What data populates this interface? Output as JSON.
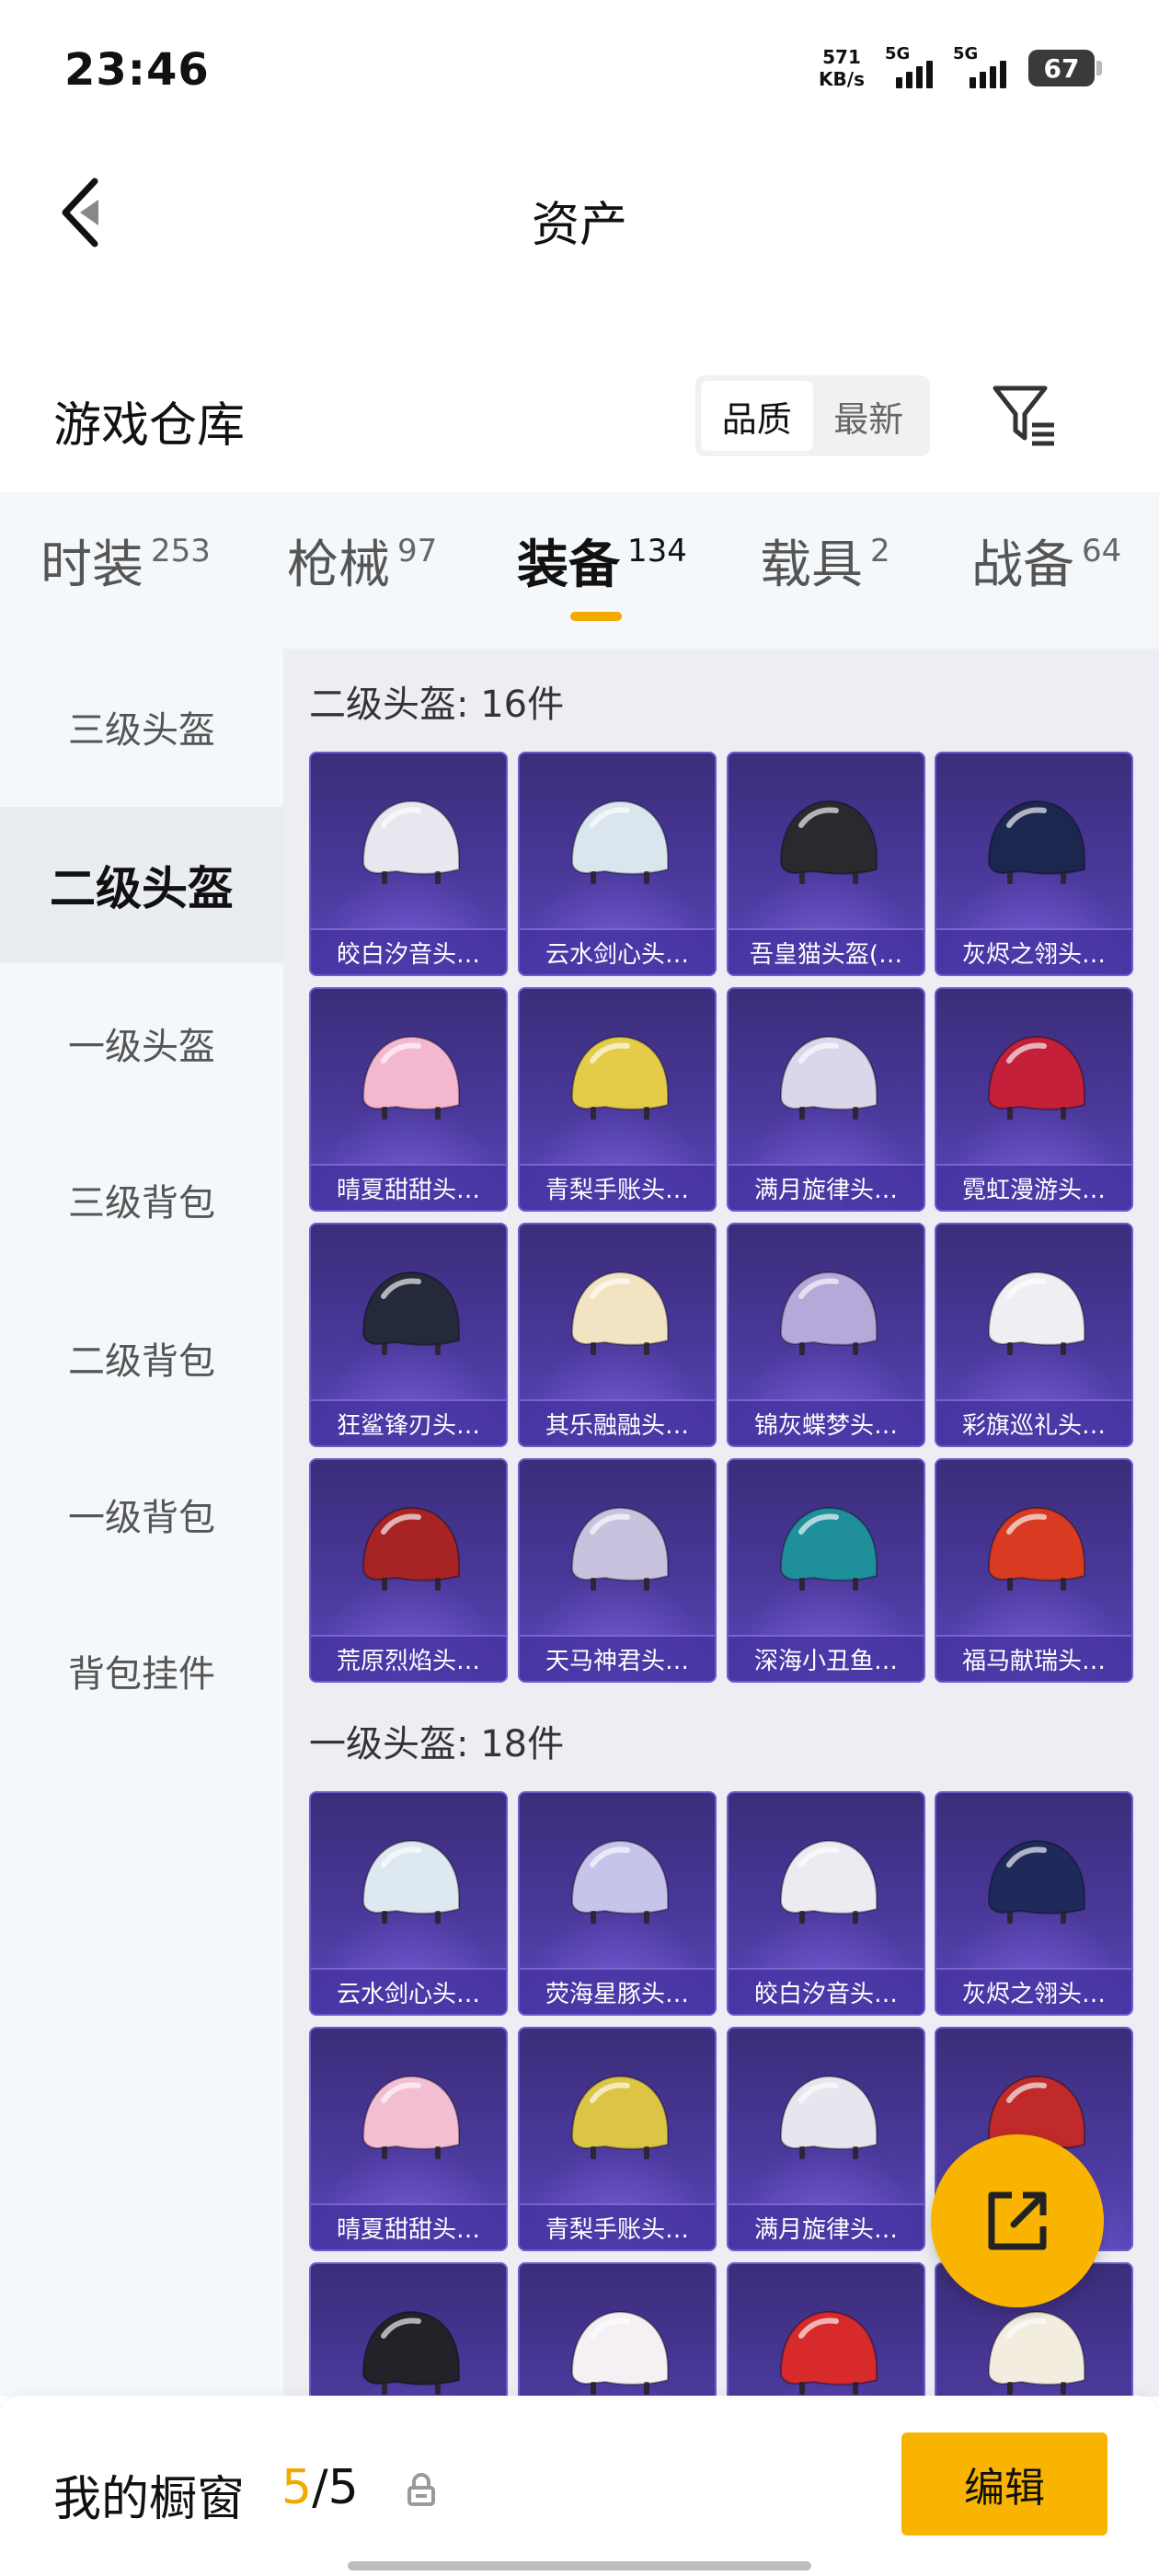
{
  "status": {
    "time": "23:46",
    "net_speed_value": "571",
    "net_speed_unit": "KB/s",
    "sim1": "5G",
    "sim2": "5G",
    "battery": "67"
  },
  "header": {
    "title": "资产"
  },
  "section": {
    "title": "游戏仓库",
    "sort_options": [
      "品质",
      "最新"
    ],
    "sort_selected": "品质"
  },
  "tabs": [
    {
      "label": "时装",
      "count": "253",
      "active": false
    },
    {
      "label": "枪械",
      "count": "97",
      "active": false
    },
    {
      "label": "装备",
      "count": "134",
      "active": true
    },
    {
      "label": "载具",
      "count": "2",
      "active": false
    },
    {
      "label": "战备",
      "count": "64",
      "active": false
    }
  ],
  "side_nav": [
    {
      "label": "三级头盔",
      "active": false
    },
    {
      "label": "二级头盔",
      "active": true
    },
    {
      "label": "一级头盔",
      "active": false
    },
    {
      "label": "三级背包",
      "active": false
    },
    {
      "label": "二级背包",
      "active": false
    },
    {
      "label": "一级背包",
      "active": false
    },
    {
      "label": "背包挂件",
      "active": false
    }
  ],
  "groups": [
    {
      "title": "二级头盔: 16件",
      "items": [
        {
          "name": "皎白汐音头…",
          "color": "#e8e6ee"
        },
        {
          "name": "云水剑心头…",
          "color": "#d9e6ee"
        },
        {
          "name": "吾皇猫头盔(…",
          "color": "#2a2a2e"
        },
        {
          "name": "灰烬之翎头…",
          "color": "#1c2750"
        },
        {
          "name": "晴夏甜甜头…",
          "color": "#f3b8cf"
        },
        {
          "name": "青梨手账头…",
          "color": "#e5cc48"
        },
        {
          "name": "满月旋律头…",
          "color": "#dcd6ea"
        },
        {
          "name": "霓虹漫游头…",
          "color": "#c4203a"
        },
        {
          "name": "狂鲨锋刃头…",
          "color": "#242a3a"
        },
        {
          "name": "其乐融融头…",
          "color": "#f2e4c2"
        },
        {
          "name": "锦灰蝶梦头…",
          "color": "#b6a8d8"
        },
        {
          "name": "彩旗巡礼头…",
          "color": "#f0eef2"
        },
        {
          "name": "荒原烈焰头…",
          "color": "#a82424"
        },
        {
          "name": "天马神君头…",
          "color": "#c9c2de"
        },
        {
          "name": "深海小丑鱼…",
          "color": "#1f8f9c"
        },
        {
          "name": "福马献瑞头…",
          "color": "#d83a22"
        }
      ]
    },
    {
      "title": "一级头盔: 18件",
      "items": [
        {
          "name": "云水剑心头…",
          "color": "#dde8f0"
        },
        {
          "name": "荧海星豚头…",
          "color": "#c6c4ea"
        },
        {
          "name": "皎白汐音头…",
          "color": "#ecebf2"
        },
        {
          "name": "灰烬之翎头…",
          "color": "#1e2a5a"
        },
        {
          "name": "晴夏甜甜头…",
          "color": "#f4bed2"
        },
        {
          "name": "青梨手账头…",
          "color": "#dcc545"
        },
        {
          "name": "满月旋律头…",
          "color": "#e6e6ee"
        },
        {
          "name": "",
          "color": "#c02a2a"
        },
        {
          "name": "",
          "color": "#222228"
        },
        {
          "name": "",
          "color": "#f4f0f4"
        },
        {
          "name": "",
          "color": "#d82a2a"
        },
        {
          "name": "",
          "color": "#f3ede0"
        }
      ]
    }
  ],
  "bottom": {
    "showcase_label": "我的橱窗",
    "showcase_current": "5",
    "showcase_sep_total": "/5",
    "edit_label": "编辑"
  },
  "colors": {
    "accent": "#f8b400",
    "card_bg": "#4a389a"
  }
}
